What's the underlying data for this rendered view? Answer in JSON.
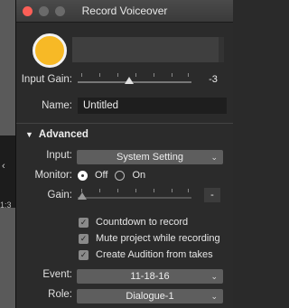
{
  "window": {
    "title": "Record Voiceover"
  },
  "input_gain": {
    "label": "Input Gain:",
    "value": "-3",
    "level": 0.45
  },
  "name": {
    "label": "Name:",
    "value": "Untitled"
  },
  "advanced": {
    "header": "Advanced",
    "input": {
      "label": "Input:",
      "value": "System Setting"
    },
    "monitor": {
      "label": "Monitor:",
      "off_label": "Off",
      "on_label": "On",
      "selected": "Off"
    },
    "gain": {
      "label": "Gain:",
      "value": "-",
      "level": 0.0
    },
    "options": [
      {
        "label": "Countdown to record",
        "checked": true
      },
      {
        "label": "Mute project while recording",
        "checked": true
      },
      {
        "label": "Create Audition from takes",
        "checked": true
      }
    ],
    "event": {
      "label": "Event:",
      "value": "11-18-16"
    },
    "role": {
      "label": "Role:",
      "value": "Dialogue-1"
    }
  },
  "background": {
    "timecode": "1:3"
  },
  "colors": {
    "record": "#f7b926",
    "close": "#fc5f57"
  }
}
